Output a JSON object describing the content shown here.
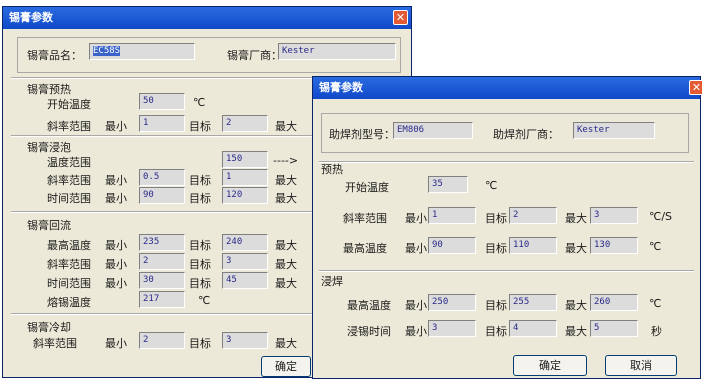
{
  "win1": {
    "title": "锡膏参数",
    "close_icon": "close-icon",
    "name_label": "锡膏品名：",
    "name_value": "EC58S",
    "vendor_label": "锡膏厂商：",
    "vendor_value": "Kester",
    "preheat": {
      "title": "锡膏预热",
      "start_label": "开始温度",
      "start_value": "50",
      "start_unit": "℃",
      "slope_label": "斜率范围",
      "min_label": "最小",
      "slope_min": "1",
      "target_label": "目标",
      "slope_target": "2",
      "max_label": "最大"
    },
    "soak": {
      "title": "锡膏浸泡",
      "temp_label": "温度范围",
      "temp_value": "150",
      "temp_arrow": "---->",
      "slope_label": "斜率范围",
      "slope_min": "0.5",
      "slope_target": "1",
      "time_label": "时间范围",
      "time_min": "90",
      "time_target": "120"
    },
    "reflow": {
      "title": "锡膏回流",
      "peak_label": "最高温度",
      "peak_min": "235",
      "peak_target": "240",
      "slope_label": "斜率范围",
      "slope_min": "2",
      "slope_target": "3",
      "time_label": "时间范围",
      "time_min": "30",
      "time_target": "45",
      "melt_label": "熔锡温度",
      "melt_value": "217",
      "melt_unit": "℃"
    },
    "cool": {
      "title": "锡膏冷却",
      "slope_label": "斜率范围",
      "slope_min": "2",
      "slope_target": "3"
    },
    "ok_label": "确定"
  },
  "win2": {
    "title": "锡膏参数",
    "close_icon": "close-icon",
    "flux_model_label": "助焊剂型号：",
    "flux_model_value": "EM806",
    "flux_vendor_label": "助焊剂厂商：",
    "flux_vendor_value": "Kester",
    "preheat": {
      "title": "预热",
      "start_label": "开始温度",
      "start_value": "35",
      "start_unit": "℃",
      "slope_label": "斜率范围",
      "min_label": "最小",
      "slope_min": "1",
      "target_label": "目标",
      "slope_target": "2",
      "max_label": "最大",
      "slope_max": "3",
      "slope_unit": "℃/S",
      "peak_label": "最高温度",
      "peak_min": "90",
      "peak_target": "110",
      "peak_max": "130",
      "peak_unit": "℃"
    },
    "dip": {
      "title": "浸焊",
      "peak_label": "最高温度",
      "peak_min": "250",
      "peak_target": "255",
      "peak_max": "260",
      "peak_unit": "℃",
      "time_label": "浸锡时间",
      "time_min": "3",
      "time_target": "4",
      "time_max": "5",
      "time_unit": "秒"
    },
    "ok_label": "确定",
    "cancel_label": "取消"
  }
}
